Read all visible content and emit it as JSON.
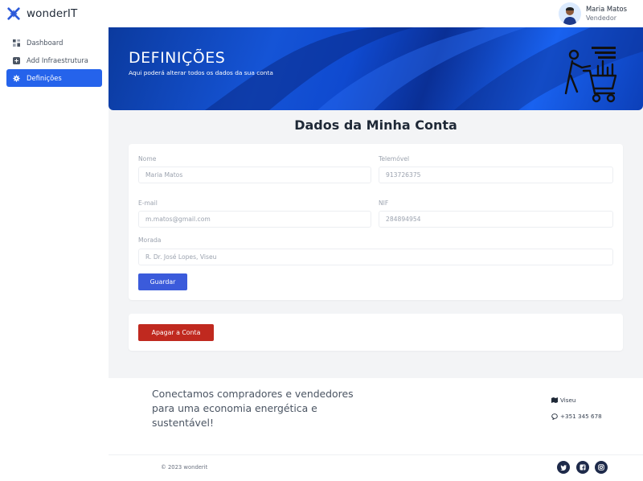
{
  "app": {
    "name": "wonderIT"
  },
  "sidebar": {
    "items": [
      {
        "label": "Dashboard",
        "icon": "dashboard-icon",
        "active": false
      },
      {
        "label": "Add Infraestrutura",
        "icon": "plus-square-icon",
        "active": false
      },
      {
        "label": "Definições",
        "icon": "gear-icon",
        "active": true
      }
    ]
  },
  "user": {
    "name": "Maria Matos",
    "role": "Vendedor"
  },
  "hero": {
    "title": "DEFINIÇÕES",
    "subtitle": "Aqui poderá alterar todos os dados da sua conta"
  },
  "section": {
    "title": "Dados da Minha Conta"
  },
  "form": {
    "nome": {
      "label": "Nome",
      "value": "Maria Matos"
    },
    "telemovel": {
      "label": "Telemóvel",
      "value": "913726375"
    },
    "email": {
      "label": "E-mail",
      "value": "m.matos@gmail.com"
    },
    "nif": {
      "label": "NIF",
      "value": "284894954"
    },
    "morada": {
      "label": "Morada",
      "value": "R. Dr. José Lopes, Viseu"
    },
    "save_label": "Guardar"
  },
  "danger": {
    "delete_label": "Apagar a Conta"
  },
  "footer": {
    "tagline": "Conectamos compradores e vendedores para uma economia energética e sustentável!",
    "location": "Viseu",
    "phone": "+351 345 678",
    "copyright": "© 2023 wonderit",
    "social": [
      "twitter-icon",
      "facebook-icon",
      "instagram-icon"
    ]
  },
  "colors": {
    "accent": "#2563eb",
    "primary_button": "#3b5bdb",
    "danger_button": "#c0291f",
    "social_bg": "#1e2a4a"
  }
}
